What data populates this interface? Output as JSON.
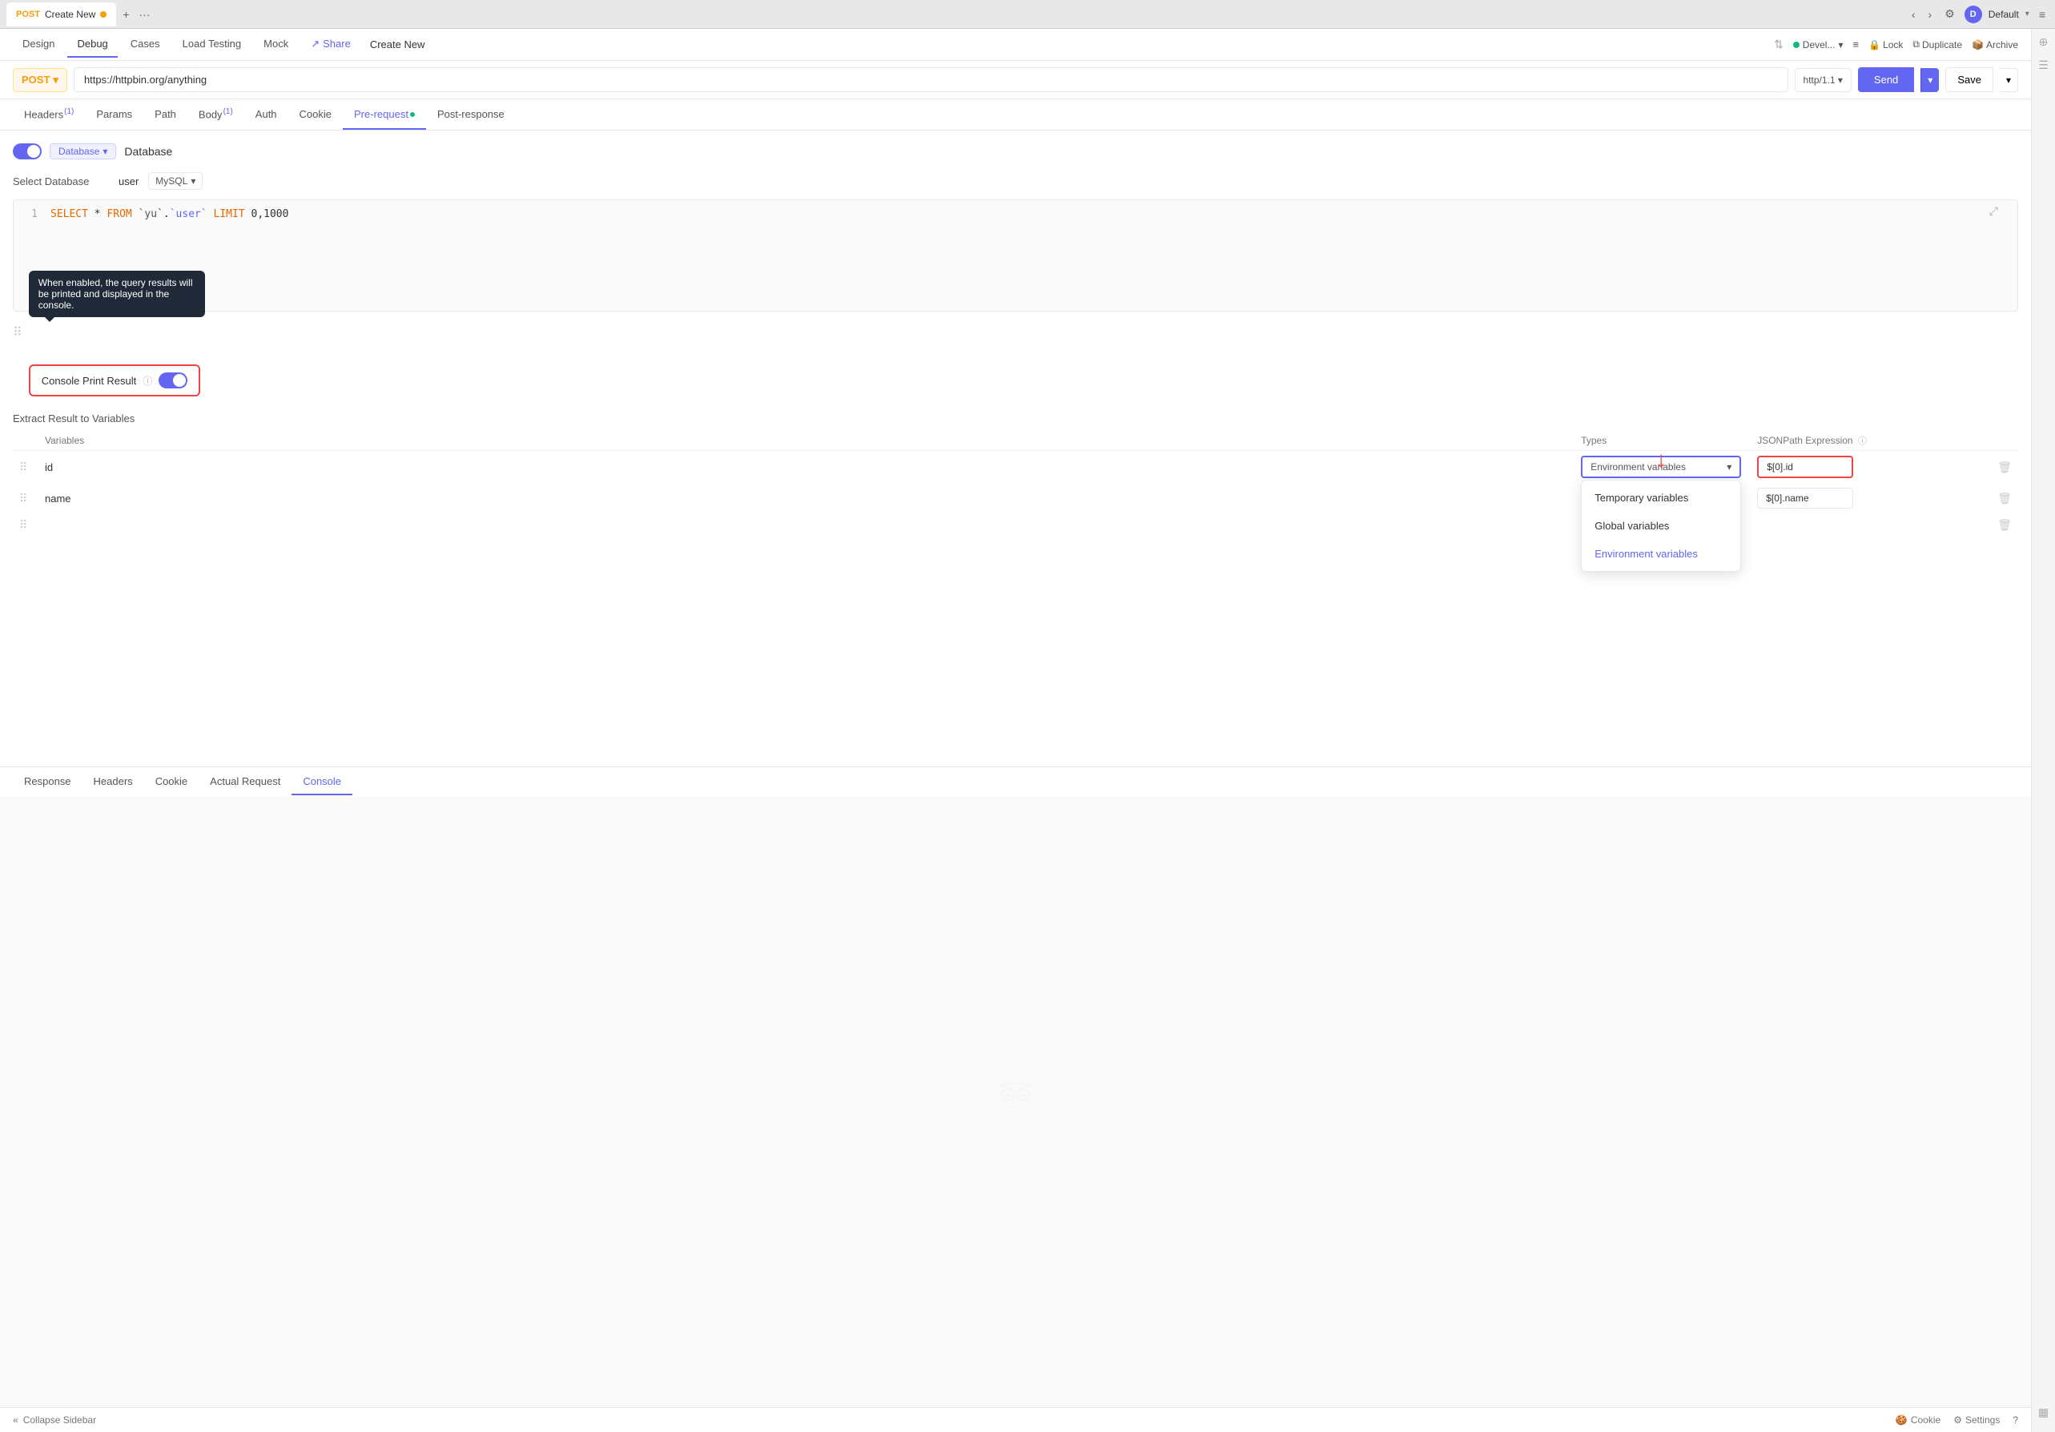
{
  "tabBar": {
    "tab": {
      "method": "POST",
      "title": "Create New",
      "dot_color": "#f59e0b"
    },
    "addBtn": "+",
    "moreBtn": "···",
    "backBtn": "‹",
    "forwardBtn": "›",
    "settingsIcon": "⚙",
    "profileLabel": "D",
    "profileName": "Default",
    "menuIcon": "≡"
  },
  "appNav": {
    "tabs": [
      {
        "id": "design",
        "label": "Design",
        "active": false
      },
      {
        "id": "debug",
        "label": "Debug",
        "active": true
      },
      {
        "id": "cases",
        "label": "Cases",
        "active": false
      },
      {
        "id": "loadtesting",
        "label": "Load Testing",
        "active": false
      },
      {
        "id": "mock",
        "label": "Mock",
        "active": false
      },
      {
        "id": "share",
        "label": "Share",
        "active": false,
        "icon": "↗"
      }
    ],
    "pageTitle": "Create New",
    "envLabel": "Devel...",
    "envDot": "#10b981",
    "listIcon": "≡",
    "lockLabel": "Lock",
    "duplicateLabel": "Duplicate",
    "archiveLabel": "Archive"
  },
  "requestBar": {
    "method": "POST",
    "url": "https://httpbin.org/anything",
    "protocol": "http/1.1",
    "sendLabel": "Send",
    "saveLabel": "Save"
  },
  "requestTabs": [
    {
      "id": "headers",
      "label": "Headers",
      "badge": "1",
      "active": false
    },
    {
      "id": "params",
      "label": "Params",
      "active": false
    },
    {
      "id": "path",
      "label": "Path",
      "active": false
    },
    {
      "id": "body",
      "label": "Body",
      "badge": "1",
      "active": false
    },
    {
      "id": "auth",
      "label": "Auth",
      "active": false
    },
    {
      "id": "cookie",
      "label": "Cookie",
      "active": false
    },
    {
      "id": "prerequest",
      "label": "Pre-request",
      "active": true,
      "dot": true
    },
    {
      "id": "postresponse",
      "label": "Post-response",
      "active": false
    }
  ],
  "preRequest": {
    "toggleOn": true,
    "sectionTag": "Database",
    "sectionTitle": "Database",
    "dbLabel": "Select Database",
    "dbValue": "user",
    "dbType": "MySQL",
    "code": {
      "lineNum": "1",
      "sql": "SELECT * FROM `yu`.`user` LIMIT 0,1000"
    },
    "consolePrintResult": {
      "label": "Console Print Result",
      "enabled": true,
      "tooltip": "When enabled, the query results will be printed and displayed in the console."
    },
    "extractTitle": "Extract Result to Variables",
    "columns": {
      "variables": "Variables",
      "types": "Types",
      "jsonpath": "JSONPath Expression"
    },
    "rows": [
      {
        "variable": "id",
        "type": "Environment variables",
        "jsonpath": "$[0].id",
        "highlighted": true
      },
      {
        "variable": "name",
        "type": "",
        "jsonpath": "$[0].name",
        "highlighted": false
      },
      {
        "variable": "",
        "type": "",
        "jsonpath": "",
        "highlighted": false
      }
    ],
    "dropdown": {
      "options": [
        {
          "label": "Temporary variables",
          "selected": false
        },
        {
          "label": "Global variables",
          "selected": false
        },
        {
          "label": "Environment variables",
          "selected": true
        }
      ]
    }
  },
  "bottomTabs": [
    {
      "id": "response",
      "label": "Response",
      "active": false
    },
    {
      "id": "headers",
      "label": "Headers",
      "active": false
    },
    {
      "id": "cookie",
      "label": "Cookie",
      "active": false
    },
    {
      "id": "actualrequest",
      "label": "Actual Request",
      "active": false
    },
    {
      "id": "console",
      "label": "Console",
      "active": true
    }
  ],
  "statusBar": {
    "collapseLabel": "Collapse Sidebar",
    "cookieLabel": "Cookie",
    "settingsLabel": "Settings",
    "helpIcon": "?"
  }
}
